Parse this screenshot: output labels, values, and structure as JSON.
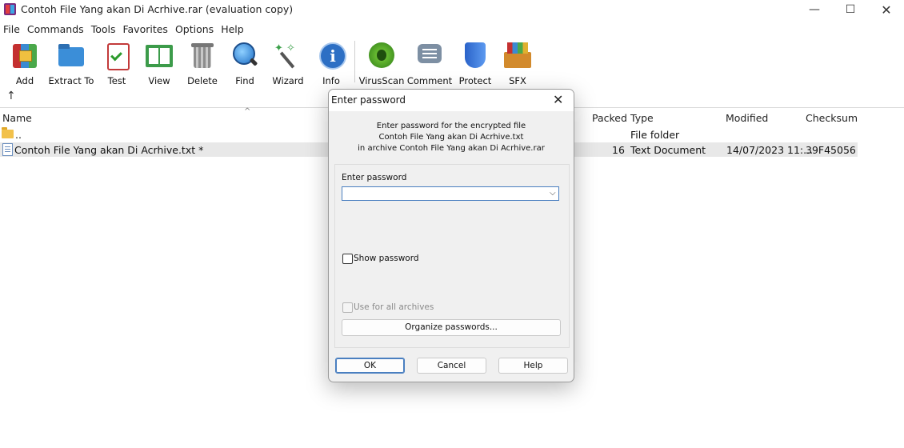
{
  "window": {
    "title": "Contoh File Yang akan Di Acrhive.rar (evaluation copy)",
    "controls": {
      "minimize": "—",
      "maximize": "☐",
      "close": "✕"
    }
  },
  "menu": [
    "File",
    "Commands",
    "Tools",
    "Favorites",
    "Options",
    "Help"
  ],
  "toolbar": {
    "buttons": [
      {
        "label": "Add",
        "icon": "add-archive-icon"
      },
      {
        "label": "Extract To",
        "icon": "extract-folder-icon"
      },
      {
        "label": "Test",
        "icon": "test-checklist-icon"
      },
      {
        "label": "View",
        "icon": "view-book-icon"
      },
      {
        "label": "Delete",
        "icon": "trash-icon"
      },
      {
        "label": "Find",
        "icon": "magnifier-icon"
      },
      {
        "label": "Wizard",
        "icon": "magic-wand-icon"
      },
      {
        "label": "Info",
        "icon": "info-icon"
      },
      {
        "label": "VirusScan",
        "icon": "virus-scan-icon"
      },
      {
        "label": "Comment",
        "icon": "comment-icon"
      },
      {
        "label": "Protect",
        "icon": "shield-icon"
      },
      {
        "label": "SFX",
        "icon": "sfx-box-icon"
      }
    ]
  },
  "nav": {
    "up_arrow": "↑"
  },
  "filelist": {
    "columns": {
      "name": "Name",
      "packed": "Packed",
      "type": "Type",
      "modified": "Modified",
      "checksum": "Checksum"
    },
    "sort_indicator": "^",
    "rows": [
      {
        "name": "..",
        "packed": "",
        "type": "File folder",
        "modified": "",
        "checksum": ""
      },
      {
        "name": "Contoh File Yang akan Di Acrhive.txt *",
        "packed": "16",
        "type": "Text Document",
        "modified": "14/07/2023 11:...",
        "checksum": "39F45056"
      }
    ]
  },
  "dialog": {
    "title": "Enter password",
    "close": "✕",
    "message_lines": [
      "Enter password for the encrypted file",
      "Contoh File Yang akan Di Acrhive.txt",
      "in archive Contoh File Yang akan Di Acrhive.rar"
    ],
    "password_label": "Enter password",
    "password_value": "",
    "combo_arrow": "⌵",
    "show_password_label": "Show password",
    "use_for_all_label": "Use for all archives",
    "organize_label": "Organize passwords...",
    "ok_label": "OK",
    "cancel_label": "Cancel",
    "help_label": "Help"
  }
}
